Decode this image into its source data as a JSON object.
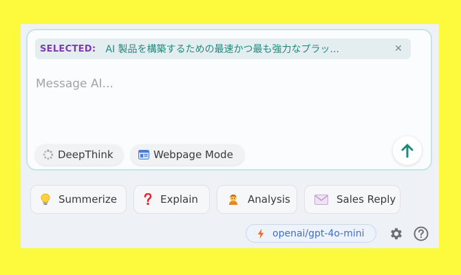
{
  "selection": {
    "label": "SELECTED:",
    "text": "AI 製品を構築するための最速かつ最も強力なプラッ...",
    "close_glyph": "✕"
  },
  "composer": {
    "placeholder": "Message AI..."
  },
  "modes": [
    {
      "label": "DeepThink",
      "icon": "spinner-icon"
    },
    {
      "label": "Webpage Mode",
      "icon": "browser-window-icon"
    }
  ],
  "actions": [
    {
      "label": "Summerize",
      "icon": "lightbulb-icon"
    },
    {
      "label": "Explain",
      "icon": "question-mark-icon"
    },
    {
      "label": "Analysis",
      "icon": "person-icon"
    },
    {
      "label": "Sales Reply",
      "icon": "envelope-icon"
    }
  ],
  "model": {
    "label": "openai/gpt-4o-mini",
    "icon": "lightning-icon"
  },
  "colors": {
    "background": "#fdf93c",
    "panel": "#eef1f6",
    "selected_label": "#7c3aad",
    "selected_text": "#21897e",
    "send_arrow": "#1e8a7a",
    "model_text": "#3f6fc4"
  }
}
